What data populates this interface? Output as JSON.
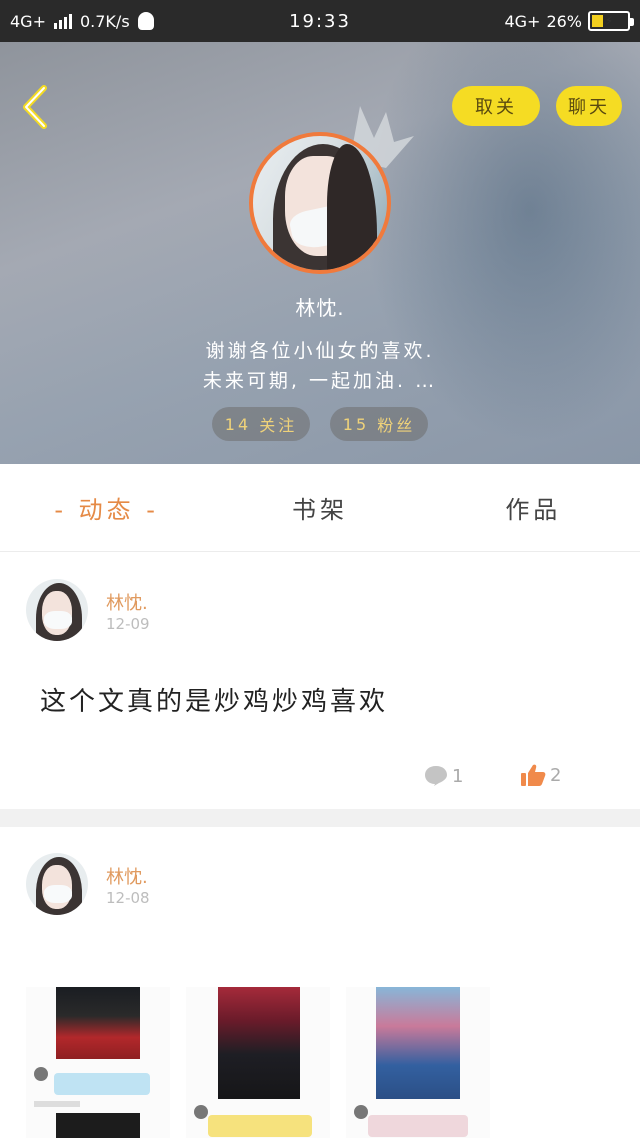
{
  "status_bar": {
    "network_left": "4G+",
    "speed": "0.7K/s",
    "time": "19:33",
    "network_right": "4G+",
    "battery_text": "26%"
  },
  "header": {
    "unfollow_label": "取关",
    "chat_label": "聊天",
    "nickname": "林忱.",
    "bio_line1": "谢谢各位小仙女的喜欢.",
    "bio_line2": "未来可期, 一起加油. …",
    "following_count": "14",
    "following_label": "关注",
    "followers_count": "15",
    "followers_label": "粉丝",
    "accent_orange": "#f07a3c",
    "accent_yellow": "#f5dc23"
  },
  "tabs": [
    {
      "label": "- 动态 -",
      "active": true
    },
    {
      "label": "书架",
      "active": false
    },
    {
      "label": "作品",
      "active": false
    }
  ],
  "posts": [
    {
      "author": "林忱.",
      "date": "12-09",
      "text": "这个文真的是炒鸡炒鸡喜欢",
      "comments": "1",
      "likes": "2"
    },
    {
      "author": "林忱.",
      "date": "12-08"
    }
  ],
  "icons": {
    "back": "back-icon",
    "crown": "crown-icon",
    "comment": "comment-icon",
    "like": "thumbs-up-icon",
    "signal": "signal-icon",
    "battery": "battery-icon",
    "qq": "qq-icon"
  }
}
